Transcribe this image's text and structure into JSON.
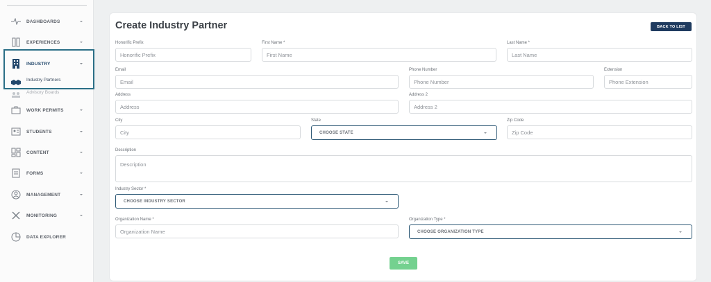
{
  "sidebar": {
    "items": [
      {
        "label": "DASHBOARDS",
        "icon": "pulse-icon"
      },
      {
        "label": "EXPERIENCES",
        "icon": "tools-icon"
      },
      {
        "label": "INDUSTRY",
        "icon": "building-icon"
      },
      {
        "label": "WORK PERMITS",
        "icon": "briefcase-icon"
      },
      {
        "label": "STUDENTS",
        "icon": "student-id-icon"
      },
      {
        "label": "CONTENT",
        "icon": "layout-icon"
      },
      {
        "label": "FORMS",
        "icon": "form-icon"
      },
      {
        "label": "MANAGEMENT",
        "icon": "user-circle-icon"
      },
      {
        "label": "MONITORING",
        "icon": "wrench-icon"
      },
      {
        "label": "DATA EXPLORER",
        "icon": "pie-chart-icon"
      }
    ],
    "subitems": [
      {
        "label": "Industry Partners"
      },
      {
        "label": "Advisory Boards"
      }
    ],
    "accent_color": "#2a6e86"
  },
  "header": {
    "title": "Create Industry Partner",
    "back_label": "BACK TO LIST"
  },
  "form": {
    "honorific": {
      "label": "Honorific Prefix",
      "placeholder": "Honorific Prefix"
    },
    "first_name": {
      "label": "First Name *",
      "placeholder": "First Name"
    },
    "last_name": {
      "label": "Last Name *",
      "placeholder": "Last Name"
    },
    "email": {
      "label": "Email",
      "placeholder": "Email"
    },
    "phone": {
      "label": "Phone Number",
      "placeholder": "Phone Number"
    },
    "extension": {
      "label": "Extension",
      "placeholder": "Phone Extension"
    },
    "address": {
      "label": "Address",
      "placeholder": "Address"
    },
    "address2": {
      "label": "Address 2",
      "placeholder": "Address 2"
    },
    "city": {
      "label": "City",
      "placeholder": "City"
    },
    "state": {
      "label": "State",
      "value": "CHOOSE STATE"
    },
    "zip": {
      "label": "Zip Code",
      "placeholder": "Zip Code"
    },
    "description": {
      "label": "Description",
      "placeholder": "Description"
    },
    "industry_sector": {
      "label": "Industry Sector *",
      "value": "CHOOSE INDUSTRY SECTOR"
    },
    "org_name": {
      "label": "Organization Name *",
      "placeholder": "Organization Name"
    },
    "org_type": {
      "label": "Organization Type *",
      "value": "CHOOSE ORGANIZATION TYPE"
    },
    "save_label": "SAVE",
    "save_color": "#74d18f"
  }
}
